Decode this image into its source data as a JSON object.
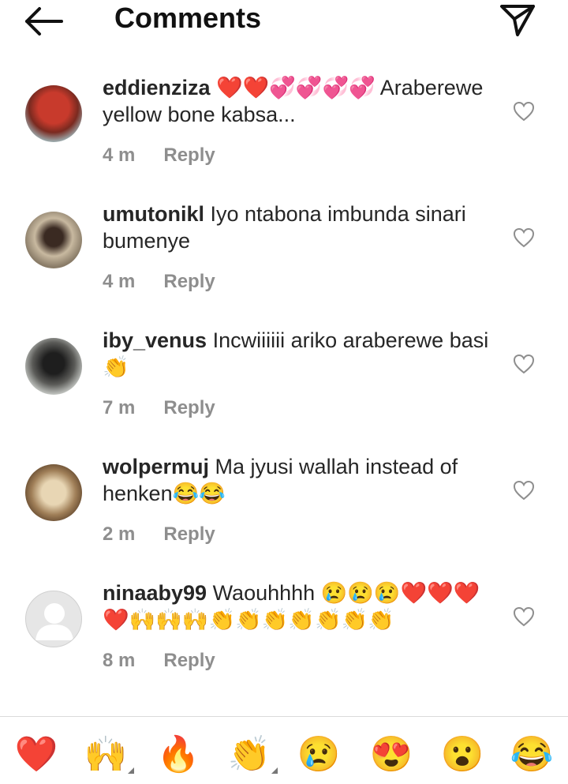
{
  "header": {
    "title": "Comments"
  },
  "comments": [
    {
      "username": "eddienziza",
      "text": "❤️❤️💞💞💞💞 Araberewe yellow bone kabsa...",
      "time": "4 m",
      "reply": "Reply"
    },
    {
      "username": "umutonikl",
      "text": "Iyo ntabona imbunda sinari bumenye",
      "time": "4 m",
      "reply": "Reply"
    },
    {
      "username": "iby_venus",
      "text": "Incwiiiiii ariko araberewe basi 👏",
      "time": "7 m",
      "reply": "Reply"
    },
    {
      "username": "wolpermuj",
      "text": "Ma jyusi wallah instead of henken😂😂",
      "time": "2 m",
      "reply": "Reply"
    },
    {
      "username": "ninaaby99",
      "text": "Waouhhhh 😢😢😢❤️❤️❤️❤️🙌🙌🙌👏👏👏👏👏👏👏",
      "time": "8 m",
      "reply": "Reply"
    }
  ],
  "emoji_bar": [
    "❤️",
    "🙌",
    "🔥",
    "👏",
    "😢",
    "😍",
    "😮",
    "😂"
  ],
  "colors": {
    "accent": "#ff0000",
    "muted": "#8e8e8e"
  }
}
